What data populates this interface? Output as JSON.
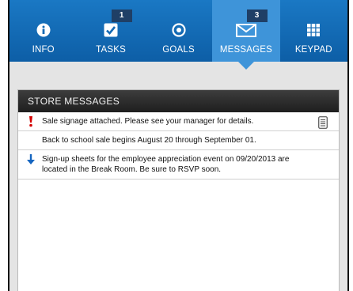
{
  "nav": {
    "items": [
      {
        "label": "INFO",
        "icon": "info-icon"
      },
      {
        "label": "TASKS",
        "icon": "checkbox-icon",
        "badge": "1"
      },
      {
        "label": "GOALS",
        "icon": "target-icon"
      },
      {
        "label": "MESSAGES",
        "icon": "envelope-icon",
        "badge": "3",
        "active": true
      },
      {
        "label": "KEYPAD",
        "icon": "keypad-icon"
      }
    ]
  },
  "store_messages": {
    "title": "STORE MESSAGES",
    "items": [
      {
        "text": "Sale signage attached. Please see your manager for details.",
        "priority": "high",
        "attachment": true
      },
      {
        "text": "Back to school sale begins August 20 through September 01.",
        "priority": "normal",
        "attachment": false
      },
      {
        "text": "Sign-up sheets for the employee appreciation event on 09/20/2013 are located in the Break Room. Be sure to RSVP soon.",
        "priority": "low",
        "attachment": false
      }
    ]
  },
  "colors": {
    "nav_bg": "#1569b6",
    "nav_active": "#3e94d9",
    "badge_bg": "#1f3f66",
    "header_bg": "#2b2b2b",
    "high_priority": "#d40000",
    "low_priority": "#1565c0"
  }
}
